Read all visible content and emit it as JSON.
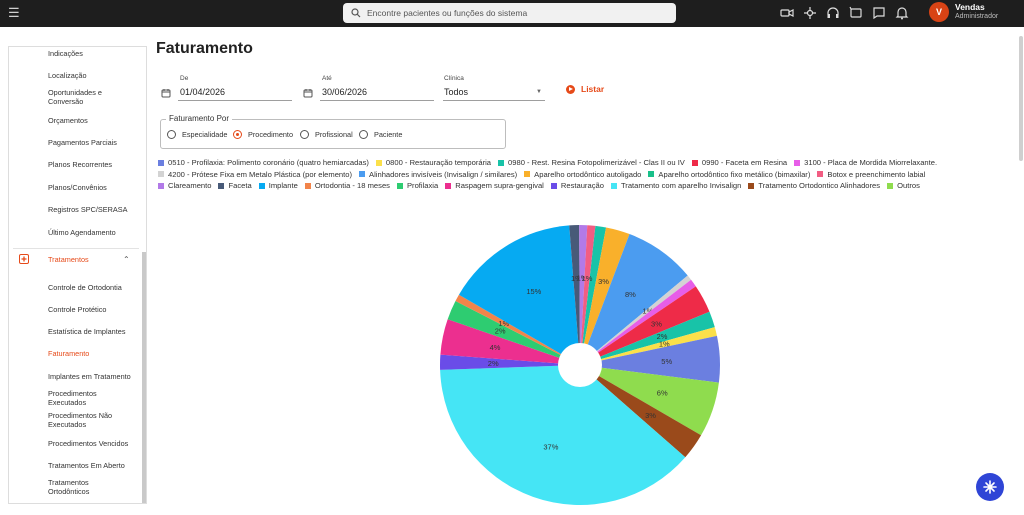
{
  "topbar": {
    "search_placeholder": "Encontre pacientes ou funções do sistema",
    "icons": [
      "video-icon",
      "pin-icon",
      "headset-icon",
      "chat-settings-icon",
      "message-icon",
      "bell-icon"
    ],
    "user": {
      "initial": "V",
      "name": "Vendas",
      "role": "Administrador"
    }
  },
  "sidebar": {
    "items_before": [
      {
        "label": "Indicações"
      },
      {
        "label": "Localização"
      },
      {
        "label": "Oportunidades e Conversão"
      },
      {
        "label": "Orçamentos"
      },
      {
        "label": "Pagamentos Parciais"
      },
      {
        "label": "Planos Recorrentes"
      },
      {
        "label": "Planos/Convênios"
      },
      {
        "label": "Registros SPC/SERASA"
      },
      {
        "label": "Último Agendamento"
      }
    ],
    "section": {
      "label": "Tratamentos",
      "accent": "#e64a19"
    },
    "items_after": [
      {
        "label": "Controle de Ortodontia"
      },
      {
        "label": "Controle Protético"
      },
      {
        "label": "Estatística de Implantes"
      },
      {
        "label": "Faturamento",
        "active": true
      },
      {
        "label": "Implantes em Tratamento"
      },
      {
        "label": "Procedimentos Executados"
      },
      {
        "label": "Procedimentos Não Executados"
      },
      {
        "label": "Procedimentos Vencidos"
      },
      {
        "label": "Tratamentos Em Aberto"
      },
      {
        "label": "Tratamentos Ortodônticos"
      }
    ]
  },
  "page": {
    "title": "Faturamento",
    "filters": {
      "de": {
        "label": "De",
        "value": "01/04/2026"
      },
      "ate": {
        "label": "Até",
        "value": "30/06/2026"
      },
      "clinica": {
        "label": "Clínica",
        "value": "Todos"
      },
      "listar_label": "Listar"
    },
    "faturamento_por": {
      "legend": "Faturamento Por",
      "options": [
        "Especialidade",
        "Procedimento",
        "Profissional",
        "Paciente"
      ],
      "selected": "Procedimento"
    }
  },
  "chart_data": {
    "type": "pie",
    "series": [
      {
        "name": "0510 - Profilaxia: Polimento coronário (quatro hemiarcadas)",
        "color": "#6b7fe0",
        "value": 5
      },
      {
        "name": "0800 - Restauração temporária",
        "color": "#fbe04a",
        "value": 1
      },
      {
        "name": "0980 - Rest. Resina Fotopolimerizável - Clas II ou IV",
        "color": "#18c3a8",
        "value": 2
      },
      {
        "name": "0990 - Faceta em Resina",
        "color": "#ee2b48",
        "value": 3
      },
      {
        "name": "3100 - Placa de Mordida Miorrelaxante.",
        "color": "#e75ee8",
        "value": 1
      },
      {
        "name": "4200 - Prótese Fixa em Metalo Plástica (por elemento)",
        "color": "#d3d3d3",
        "value": 1
      },
      {
        "name": "Alinhadores invisíveis (Invisalign / similares)",
        "color": "#4b9cf0",
        "value": 8
      },
      {
        "name": "Aparelho ortodôntico autoligado",
        "color": "#f9b02b",
        "value": 3
      },
      {
        "name": "Aparelho ortodôntico fixo metálico (bimaxilar)",
        "color": "#19c08a",
        "value": 2
      },
      {
        "name": "Botox e preenchimento labial",
        "color": "#f25d83",
        "value": 1
      },
      {
        "name": "Clareamento",
        "color": "#b27ae8",
        "value": 1
      },
      {
        "name": "Faceta",
        "color": "#485a78",
        "value": 1
      },
      {
        "name": "Implante",
        "color": "#06aaf2",
        "value": 15
      },
      {
        "name": "Ortodontia - 18 meses",
        "color": "#f2844a",
        "value": 1
      },
      {
        "name": "Profilaxia",
        "color": "#2ecc71",
        "value": 2
      },
      {
        "name": "Raspagem supra-gengival",
        "color": "#ec2f8f",
        "value": 4
      },
      {
        "name": "Restauração",
        "color": "#6a4ce8",
        "value": 2
      },
      {
        "name": "Tratamento com aparelho Invisalign",
        "color": "#45e5f5",
        "value": 37
      },
      {
        "name": "Tratamento Ortodontico Alinhadores",
        "color": "#9a4a1b",
        "value": 3
      },
      {
        "name": "Outros",
        "color": "#8fdc4e",
        "value": 6
      }
    ],
    "slice_order": [
      {
        "name": "0980 - Rest. Resina Fotopolimerizável - Clas II ou IV",
        "value": 1.2,
        "label": ""
      },
      {
        "name": "Aparelho ortodôntico autoligado",
        "value": 2.7,
        "label": "3%"
      },
      {
        "name": "Alinhadores invisíveis (Invisalign / similares)",
        "value": 8,
        "label": "8%"
      },
      {
        "name": "4200 - Prótese Fixa em Metalo Plástica (por elemento)",
        "value": 0.6,
        "label": "1%"
      },
      {
        "name": "3100 - Placa de Mordida Miorrelaxante.",
        "value": 0.9,
        "label": ""
      },
      {
        "name": "0990 - Faceta em Resina",
        "value": 3.2,
        "label": "3%"
      },
      {
        "name": "0980 - Rest. Resina Fotopolimerizável - Clas II ou IV",
        "value": 1.8,
        "label": "2%"
      },
      {
        "name": "0800 - Restauração temporária",
        "value": 1,
        "label": "1%"
      },
      {
        "name": "0510 - Profilaxia: Polimento coronário (quatro hemiarcadas)",
        "value": 5.2,
        "label": "5%"
      },
      {
        "name": "Outros",
        "value": 6.2,
        "label": "6%"
      },
      {
        "name": "Tratamento Ortodontico Alinhadores",
        "value": 3,
        "label": "3%"
      },
      {
        "name": "Tratamento com aparelho Invisalign",
        "value": 37,
        "label": "37%"
      },
      {
        "name": "Restauração",
        "value": 1.7,
        "label": "2%"
      },
      {
        "name": "Raspagem supra-gengival",
        "value": 4,
        "label": "4%"
      },
      {
        "name": "Profilaxia",
        "value": 2.2,
        "label": "2%"
      },
      {
        "name": "Ortodontia - 18 meses",
        "value": 0.8,
        "label": "1%"
      },
      {
        "name": "Implante",
        "value": 15,
        "label": "15%"
      },
      {
        "name": "Faceta",
        "value": 1.1,
        "label": "1%"
      },
      {
        "name": "Clareamento",
        "value": 0.9,
        "label": "1%"
      },
      {
        "name": "Botox e preenchimento labial",
        "value": 0.9,
        "label": "1%"
      }
    ],
    "legend_position": "top",
    "hole": true
  }
}
